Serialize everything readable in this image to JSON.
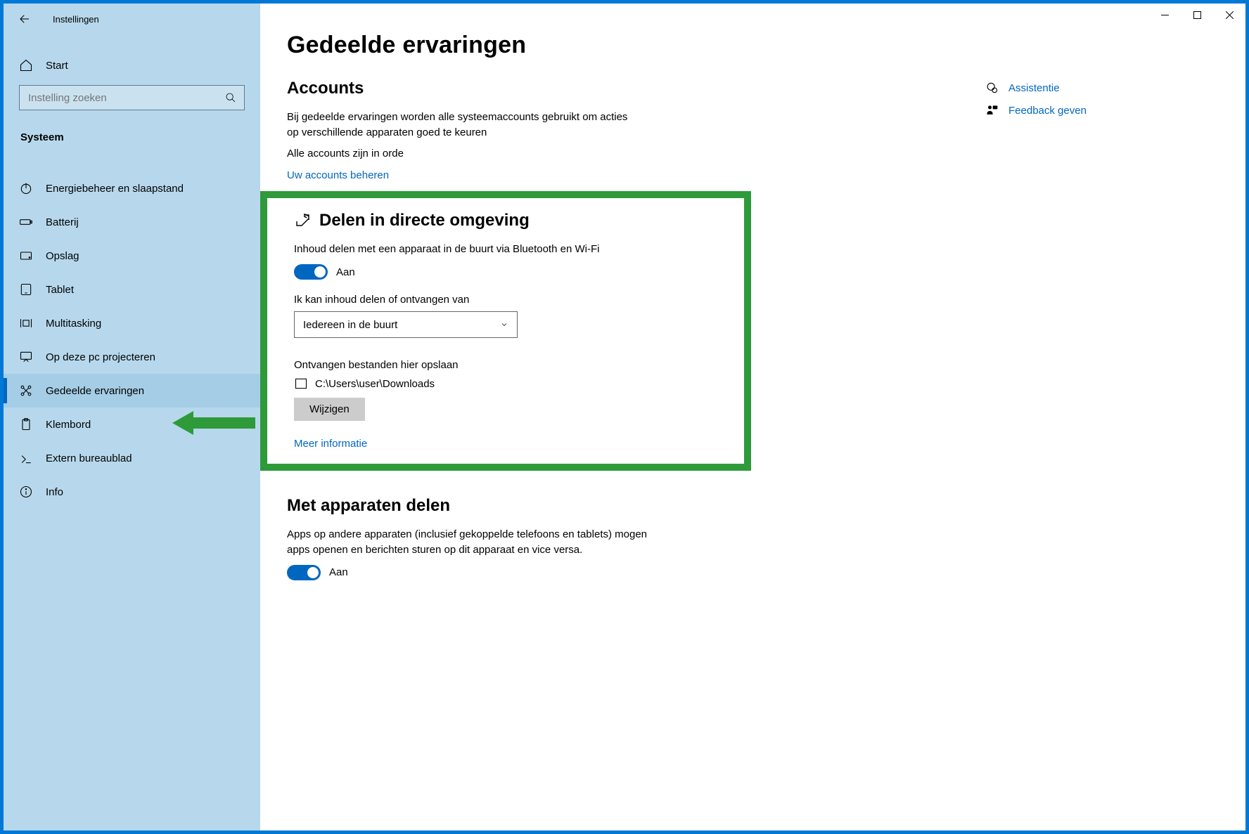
{
  "app": {
    "title": "Instellingen"
  },
  "sidebar": {
    "home": "Start",
    "search_placeholder": "Instelling zoeken",
    "category": "Systeem",
    "items": [
      {
        "label": "Energiebeheer en slaapstand"
      },
      {
        "label": "Batterij"
      },
      {
        "label": "Opslag"
      },
      {
        "label": "Tablet"
      },
      {
        "label": "Multitasking"
      },
      {
        "label": "Op deze pc projecteren"
      },
      {
        "label": "Gedeelde ervaringen"
      },
      {
        "label": "Klembord"
      },
      {
        "label": "Extern bureaublad"
      },
      {
        "label": "Info"
      }
    ]
  },
  "page": {
    "title": "Gedeelde ervaringen",
    "accounts": {
      "heading": "Accounts",
      "desc": "Bij gedeelde ervaringen worden alle systeemaccounts gebruikt om acties op verschillende apparaten goed te keuren",
      "status": "Alle accounts zijn in orde",
      "manage_link": "Uw accounts beheren"
    },
    "nearby": {
      "heading": "Delen in directe omgeving",
      "desc": "Inhoud delen met een apparaat in de buurt via Bluetooth en Wi-Fi",
      "toggle_state": "Aan",
      "receive_label": "Ik kan inhoud delen of ontvangen van",
      "receive_value": "Iedereen in de buurt",
      "save_label": "Ontvangen bestanden hier opslaan",
      "save_path": "C:\\Users\\user\\Downloads",
      "change_btn": "Wijzigen",
      "more_link": "Meer informatie"
    },
    "cross_device": {
      "heading": "Met apparaten delen",
      "desc": "Apps op andere apparaten (inclusief gekoppelde telefoons en tablets) mogen apps openen en berichten sturen op dit apparaat en vice versa.",
      "toggle_state": "Aan"
    }
  },
  "aside": {
    "help": "Assistentie",
    "feedback": "Feedback geven"
  }
}
